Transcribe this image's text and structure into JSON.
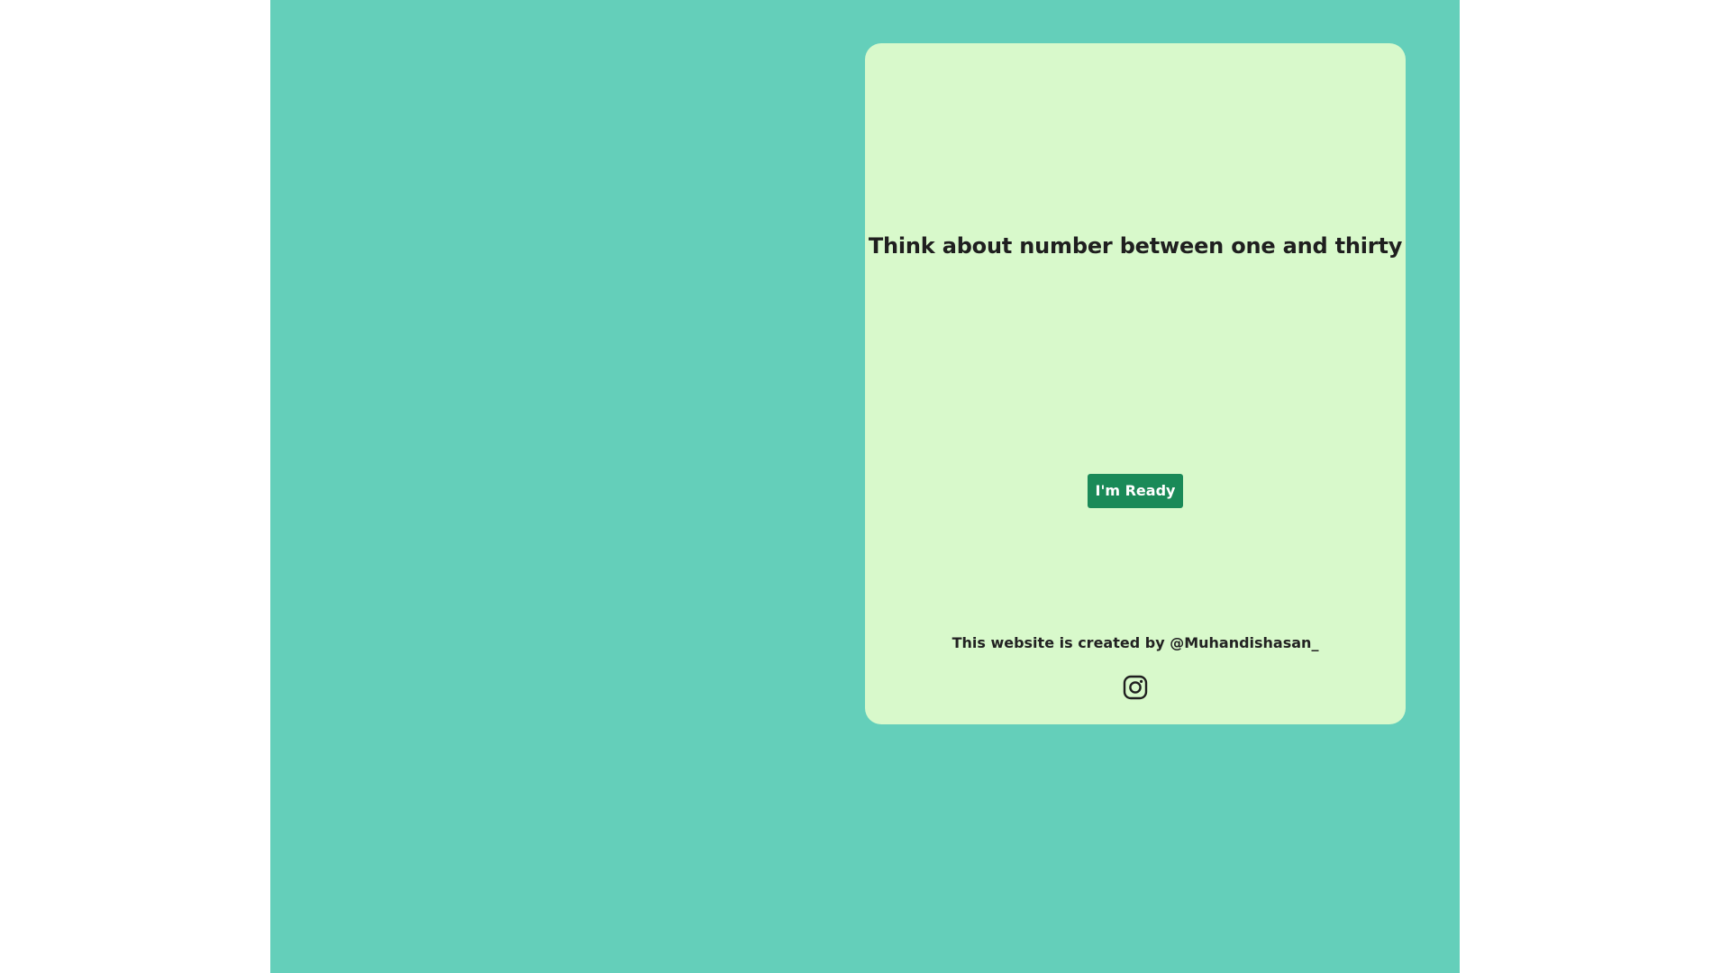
{
  "card": {
    "headline": "Think about number between one and thirty",
    "ready_button_label": "I'm Ready",
    "credit_text": "This website is created by @Muhandishasan_",
    "social_icon": "instagram-icon"
  },
  "colors": {
    "page_background": "#64cfba",
    "card_background": "#d8f9cb",
    "button_background": "#1a8a58",
    "text": "#1f1f1f"
  }
}
